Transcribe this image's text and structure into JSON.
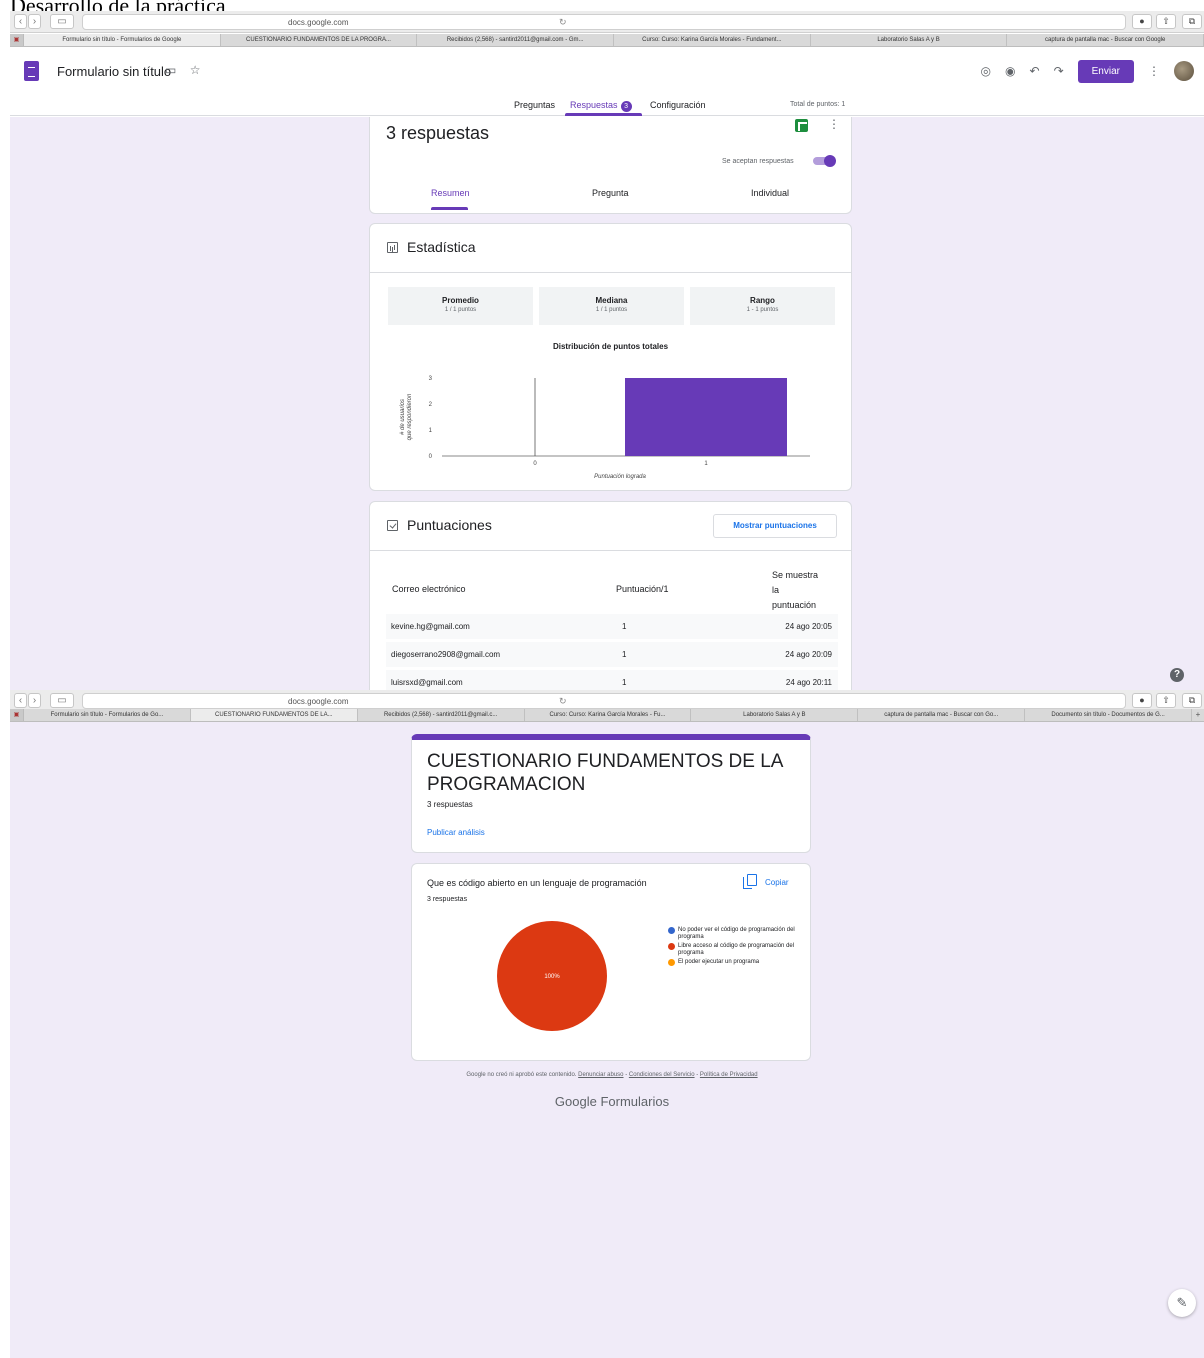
{
  "doc_heading": "Desarrollo de la práctica",
  "browser1": {
    "url": "docs.google.com",
    "tabs": [
      "Formulario sin título - Formularios de Google",
      "CUESTIONARIO FUNDAMENTOS DE LA PROGRA...",
      "Recibidos (2,568) - santird2011@gmail.com - Gm...",
      "Curso: Curso: Karina García Morales - Fundament...",
      "Laboratorio Salas A y B",
      "captura de pantalla mac - Buscar con Google"
    ]
  },
  "forms_header": {
    "title": "Formulario sin título",
    "send_label": "Enviar",
    "tabs": {
      "preguntas": "Preguntas",
      "respuestas": "Respuestas",
      "respuestas_badge": "3",
      "configuracion": "Configuración"
    },
    "total_points": "Total de puntos: 1"
  },
  "responses_card": {
    "title": "3 respuestas",
    "accepting_label": "Se aceptan respuestas",
    "subtabs": [
      "Resumen",
      "Pregunta",
      "Individual"
    ]
  },
  "stats_card": {
    "title": "Estadística",
    "stats": [
      {
        "label": "Promedio",
        "value": "1 / 1 puntos"
      },
      {
        "label": "Mediana",
        "value": "1 / 1 puntos"
      },
      {
        "label": "Rango",
        "value": "1 - 1 puntos"
      }
    ]
  },
  "chart_data": {
    "type": "bar",
    "title": "Distribución de puntos totales",
    "xlabel": "Puntuación lograda",
    "ylabel": "# de usuarios que respondieron",
    "categories": [
      "0",
      "1"
    ],
    "values": [
      0,
      3
    ],
    "ylim": [
      0,
      3
    ],
    "yticks": [
      "0",
      "1",
      "2",
      "3"
    ],
    "color": "#673ab7"
  },
  "scores_card": {
    "title": "Puntuaciones",
    "show_button": "Mostrar puntuaciones",
    "headers": {
      "email": "Correo electrónico",
      "score": "Puntuación/1",
      "shown_l1": "Se muestra",
      "shown_l2": "la",
      "shown_l3": "puntuación"
    },
    "rows": [
      {
        "email": "kevine.hg@gmail.com",
        "score": "1",
        "date": "24 ago 20:05"
      },
      {
        "email": "diegoserrano2908@gmail.com",
        "score": "1",
        "date": "24 ago 20:09"
      },
      {
        "email": "luisrsxd@gmail.com",
        "score": "1",
        "date": "24 ago 20:11"
      }
    ]
  },
  "browser2": {
    "url": "docs.google.com",
    "tabs": [
      "Formulario sin título - Formularios de Go...",
      "CUESTIONARIO FUNDAMENTOS DE LA...",
      "Recibidos (2,568) - santird2011@gmail.c...",
      "Curso: Curso: Karina García Morales - Fu...",
      "Laboratorio Salas A y B",
      "captura de pantalla mac - Buscar con Go...",
      "Documento sin título - Documentos de G..."
    ]
  },
  "analysis": {
    "form_title": "CUESTIONARIO FUNDAMENTOS DE LA PROGRAMACION",
    "count": "3 respuestas",
    "publish_link": "Publicar análisis",
    "question": "Que es código abierto en un lenguaje de programación",
    "question_count": "3 respuestas",
    "copy_label": "Copiar",
    "pie": {
      "type": "pie",
      "slices": [
        {
          "label": "No poder ver el código de programación del programa",
          "value": 0,
          "color": "#3366cc"
        },
        {
          "label": "Libre acceso al código de programación del programa",
          "value": 100,
          "color": "#dc3912"
        },
        {
          "label": "El poder ejecutar un programa",
          "value": 0,
          "color": "#ff9900"
        }
      ],
      "center_label": "100%"
    },
    "footer": {
      "prefix": "Google no creó ni aprobó este contenido.",
      "abuse": "Denunciar abuso",
      "terms": "Condiciones del Servicio",
      "privacy": "Política de Privacidad",
      "sep": "-"
    },
    "brand_google": "Google",
    "brand_forms": "Formularios"
  }
}
